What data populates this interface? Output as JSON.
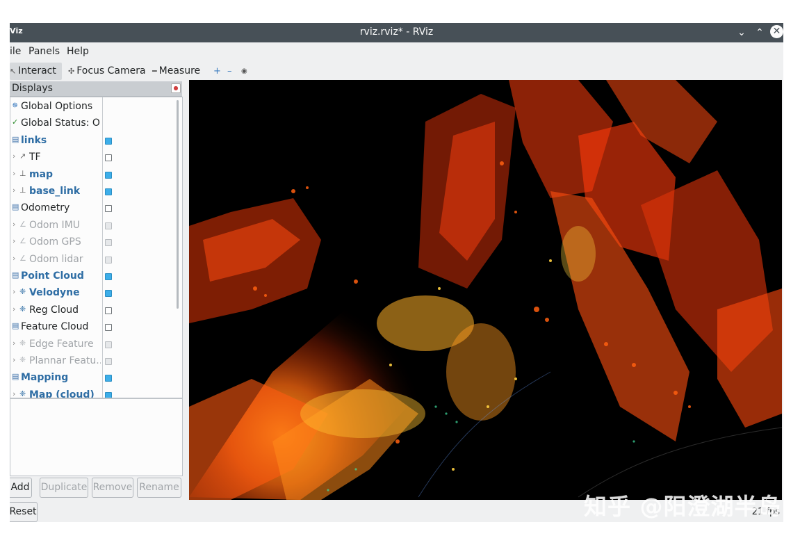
{
  "window": {
    "app_icon": "Vı̈z",
    "title": "rviz.rviz* - RViz"
  },
  "menubar": [
    "ile",
    "Panels",
    "Help"
  ],
  "toolbar": {
    "interact": "Interact",
    "focus_camera": "Focus Camera",
    "measure": "Measure"
  },
  "displays_panel": {
    "title": "Displays",
    "items": [
      {
        "label": "Global Options",
        "icon": "globe-icon",
        "checkbox": null,
        "bold": false,
        "disabled": false,
        "indent": 0
      },
      {
        "label": "Global Status: Ok",
        "icon": "checkmark-icon",
        "checkbox": null,
        "bold": false,
        "disabled": false,
        "indent": 0
      },
      {
        "label": "links",
        "icon": "folder-icon",
        "checkbox": "on",
        "bold": true,
        "disabled": false,
        "indent": 0
      },
      {
        "label": "TF",
        "icon": "tf-icon",
        "checkbox": "off",
        "bold": false,
        "disabled": false,
        "indent": 1
      },
      {
        "label": "map",
        "icon": "axes-icon",
        "checkbox": "on",
        "bold": true,
        "disabled": false,
        "indent": 1
      },
      {
        "label": "base_link",
        "icon": "axes-icon",
        "checkbox": "on",
        "bold": true,
        "disabled": false,
        "indent": 1
      },
      {
        "label": "Odometry",
        "icon": "folder-icon",
        "checkbox": "off",
        "bold": false,
        "disabled": false,
        "indent": 0
      },
      {
        "label": "Odom IMU",
        "icon": "odometry-icon",
        "checkbox": "dim",
        "bold": false,
        "disabled": true,
        "indent": 1
      },
      {
        "label": "Odom GPS",
        "icon": "odometry-icon",
        "checkbox": "dim",
        "bold": false,
        "disabled": true,
        "indent": 1
      },
      {
        "label": "Odom lidar",
        "icon": "odometry-icon",
        "checkbox": "dimoff",
        "bold": false,
        "disabled": true,
        "indent": 1
      },
      {
        "label": "Point Cloud",
        "icon": "folder-icon",
        "checkbox": "on",
        "bold": true,
        "disabled": false,
        "indent": 0
      },
      {
        "label": "Velodyne",
        "icon": "pointcloud-icon",
        "checkbox": "on",
        "bold": true,
        "disabled": false,
        "indent": 1
      },
      {
        "label": "Reg Cloud",
        "icon": "pointcloud-icon",
        "checkbox": "off",
        "bold": false,
        "disabled": false,
        "indent": 1
      },
      {
        "label": "Feature Cloud",
        "icon": "folder-icon",
        "checkbox": "off",
        "bold": false,
        "disabled": false,
        "indent": 0
      },
      {
        "label": "Edge Feature",
        "icon": "pointcloud-icon",
        "checkbox": "dim",
        "bold": false,
        "disabled": true,
        "indent": 1
      },
      {
        "label": "Plannar Featu...",
        "icon": "pointcloud-icon",
        "checkbox": "dim",
        "bold": false,
        "disabled": true,
        "indent": 1
      },
      {
        "label": "Mapping",
        "icon": "folder-icon",
        "checkbox": "on",
        "bold": true,
        "disabled": false,
        "indent": 0
      },
      {
        "label": "Map (cloud)",
        "icon": "pointcloud-icon",
        "checkbox": "on",
        "bold": true,
        "disabled": false,
        "indent": 1
      }
    ]
  },
  "buttons": {
    "add": "Add",
    "duplicate": "Duplicate",
    "remove": "Remove",
    "rename": "Rename",
    "reset": "Reset"
  },
  "status": {
    "fps": "21 fps"
  },
  "watermark": "知乎 @阳澄湖半岛"
}
